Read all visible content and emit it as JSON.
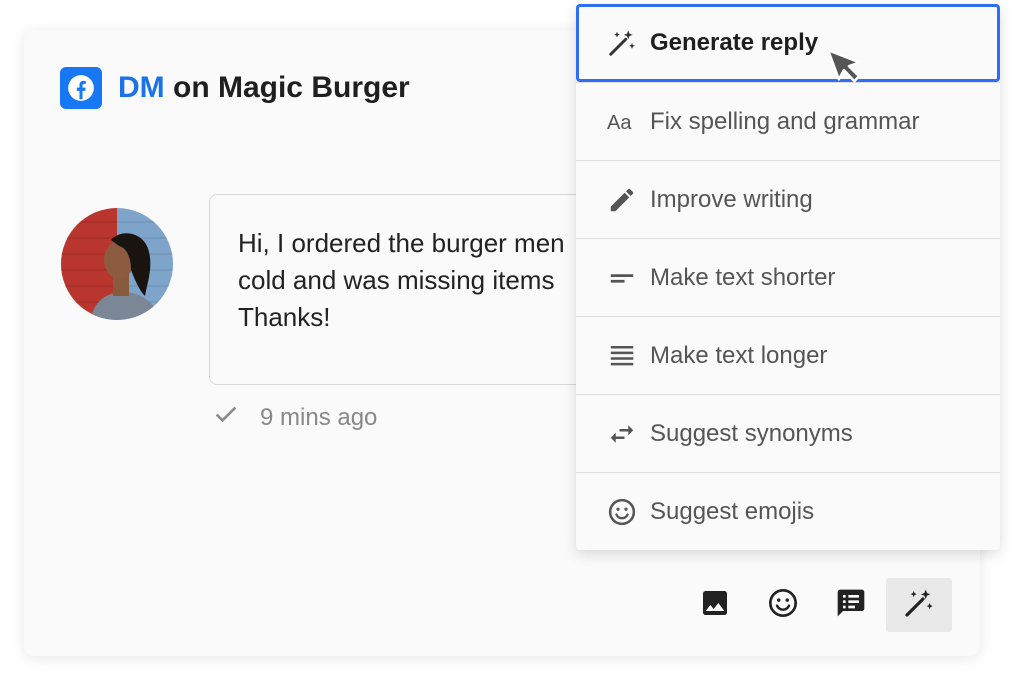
{
  "header": {
    "channel": "DM",
    "title_rest": " on Magic Burger",
    "brand_color": "#1877f2",
    "accent_color": "#1a73e8"
  },
  "message": {
    "lines": [
      "Hi, I ordered the burger men",
      "cold and was missing items",
      "Thanks!"
    ],
    "time": "9 mins ago"
  },
  "ai_menu": {
    "items": [
      {
        "label": "Generate reply",
        "icon": "sparkle-icon",
        "active": true
      },
      {
        "label": "Fix spelling and grammar",
        "icon": "text-format-icon"
      },
      {
        "label": "Improve writing",
        "icon": "pencil-icon"
      },
      {
        "label": "Make text shorter",
        "icon": "short-text-icon"
      },
      {
        "label": "Make text longer",
        "icon": "long-text-icon"
      },
      {
        "label": "Suggest synonyms",
        "icon": "swap-arrows-icon"
      },
      {
        "label": "Suggest emojis",
        "icon": "smiley-icon"
      }
    ],
    "highlight_color": "#2f6df5"
  },
  "toolbar": {
    "buttons": [
      "image-icon",
      "emoji-icon",
      "saved-reply-icon",
      "ai-assist-icon"
    ]
  }
}
